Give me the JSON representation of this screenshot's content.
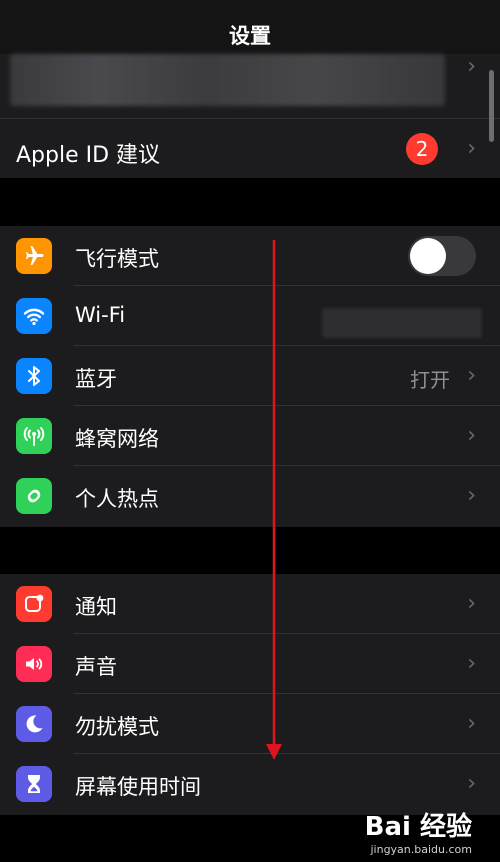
{
  "nav": {
    "title": "设置"
  },
  "profile": {
    "apple_id_label": "Apple ID 建议",
    "badge_count": "2"
  },
  "group1": [
    {
      "label": "飞行模式",
      "icon": "airplane-icon",
      "color": "#ff9500",
      "control": "toggle",
      "on": false
    },
    {
      "label": "Wi-Fi",
      "icon": "wifi-icon",
      "color": "#0a84ff",
      "control": "chevron"
    },
    {
      "label": "蓝牙",
      "icon": "bluetooth-icon",
      "color": "#0a84ff",
      "value": "打开",
      "control": "chevron"
    },
    {
      "label": "蜂窝网络",
      "icon": "cellular-icon",
      "color": "#30d158",
      "control": "chevron"
    },
    {
      "label": "个人热点",
      "icon": "hotspot-icon",
      "color": "#30d158",
      "control": "chevron"
    }
  ],
  "group2": [
    {
      "label": "通知",
      "icon": "notification-icon",
      "color": "#ff3b30",
      "control": "chevron"
    },
    {
      "label": "声音",
      "icon": "speaker-icon",
      "color": "#ff2d55",
      "control": "chevron"
    },
    {
      "label": "勿扰模式",
      "icon": "moon-icon",
      "color": "#5e5ce6",
      "control": "chevron"
    },
    {
      "label": "屏幕使用时间",
      "icon": "hourglass-icon",
      "color": "#5e5ce6",
      "control": "chevron"
    }
  ],
  "annotation": {
    "arrow_color": "#e0141e"
  },
  "watermark": {
    "logo": "Bai 经验",
    "url": "jingyan.baidu.com"
  }
}
